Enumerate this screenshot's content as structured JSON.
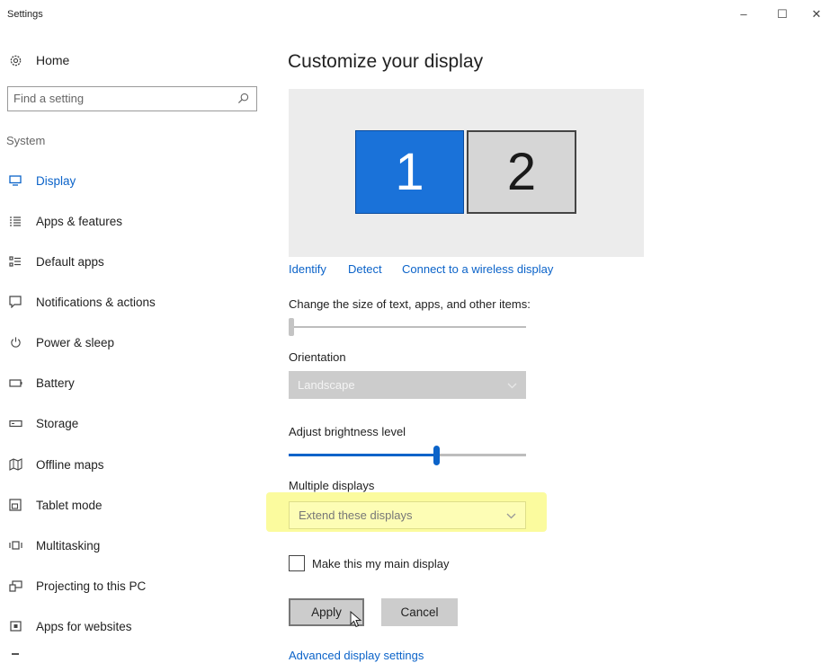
{
  "window": {
    "title": "Settings",
    "minimize": "–",
    "maximize": "☐",
    "close": "✕"
  },
  "sidebar": {
    "home": "Home",
    "search_placeholder": "Find a setting",
    "section": "System",
    "items": [
      {
        "label": "Display",
        "icon": "monitor-icon",
        "active": true
      },
      {
        "label": "Apps & features",
        "icon": "list-icon"
      },
      {
        "label": "Default apps",
        "icon": "default-apps-icon"
      },
      {
        "label": "Notifications & actions",
        "icon": "notification-icon"
      },
      {
        "label": "Power & sleep",
        "icon": "power-icon"
      },
      {
        "label": "Battery",
        "icon": "battery-icon"
      },
      {
        "label": "Storage",
        "icon": "storage-icon"
      },
      {
        "label": "Offline maps",
        "icon": "map-icon"
      },
      {
        "label": "Tablet mode",
        "icon": "tablet-icon"
      },
      {
        "label": "Multitasking",
        "icon": "multitasking-icon"
      },
      {
        "label": "Projecting to this PC",
        "icon": "projecting-icon"
      },
      {
        "label": "Apps for websites",
        "icon": "apps-websites-icon"
      }
    ]
  },
  "main": {
    "title": "Customize your display",
    "monitors": [
      "1",
      "2"
    ],
    "links": {
      "identify": "Identify",
      "detect": "Detect",
      "wireless": "Connect to a wireless display"
    },
    "scale_label": "Change the size of text, apps, and other items:",
    "scale_level": 0.0,
    "orientation_label": "Orientation",
    "orientation_value": "Landscape",
    "brightness_label": "Adjust brightness level",
    "brightness_level": 0.62,
    "multiple_label": "Multiple displays",
    "multiple_value": "Extend these displays",
    "main_display_label": "Make this my main display",
    "main_display_checked": false,
    "apply": "Apply",
    "cancel": "Cancel",
    "advanced": "Advanced display settings"
  },
  "colors": {
    "accent": "#0b63c9",
    "monitor_selected": "#1a72d9",
    "highlight": "#fbfb9e"
  }
}
